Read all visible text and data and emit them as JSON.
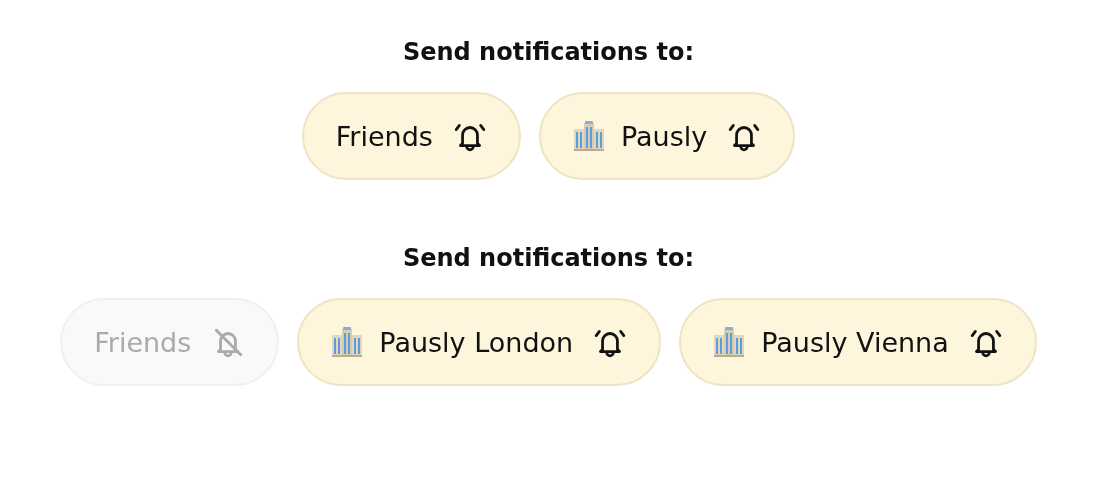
{
  "sections": [
    {
      "heading": "Send notifications to:",
      "chips": [
        {
          "label": "Friends",
          "kind": "group",
          "on": true
        },
        {
          "label": "Pausly",
          "kind": "org",
          "on": true
        }
      ]
    },
    {
      "heading": "Send notifications to:",
      "chips": [
        {
          "label": "Friends",
          "kind": "group",
          "on": false
        },
        {
          "label": "Pausly London",
          "kind": "org",
          "on": true
        },
        {
          "label": "Pausly Vienna",
          "kind": "org",
          "on": true
        }
      ]
    }
  ]
}
